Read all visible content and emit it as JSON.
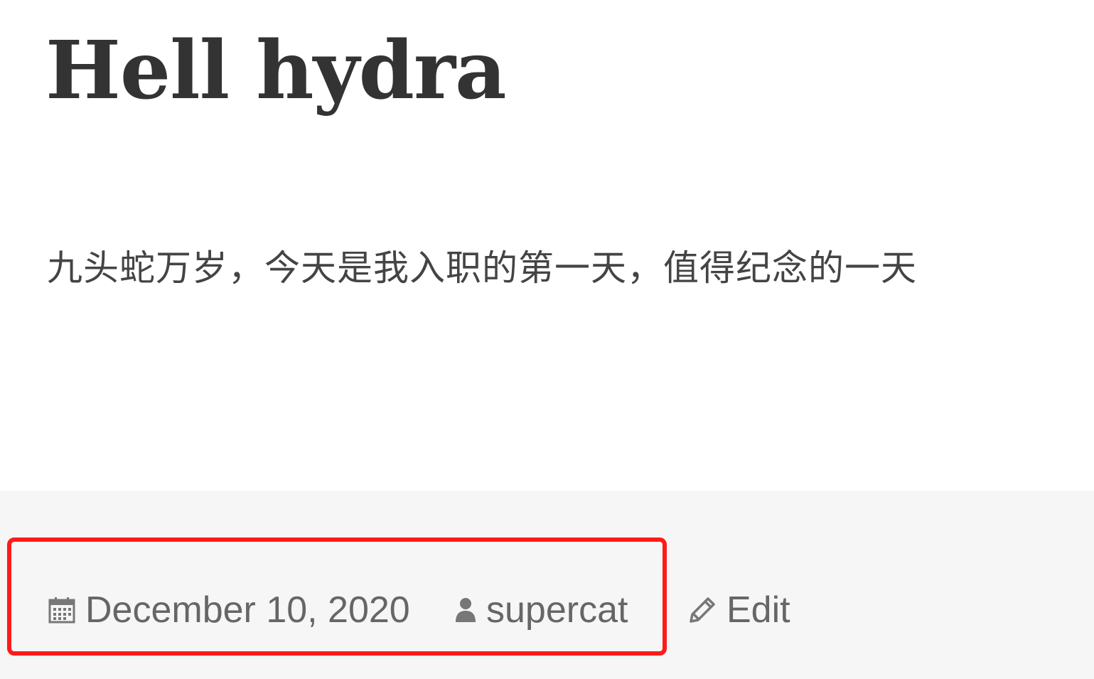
{
  "post": {
    "title": "Hell hydra",
    "content": "九头蛇万岁，今天是我入职的第一天，值得纪念的一天"
  },
  "meta": {
    "date": "December 10, 2020",
    "author": "supercat",
    "edit_label": "Edit",
    "icons": {
      "date": "calendar-icon",
      "author": "user-icon",
      "edit": "pencil-icon"
    }
  },
  "colors": {
    "title": "#333333",
    "text": "#444444",
    "meta": "#666666",
    "footer_bg": "#f6f6f6",
    "highlight": "#ff1a1a"
  }
}
